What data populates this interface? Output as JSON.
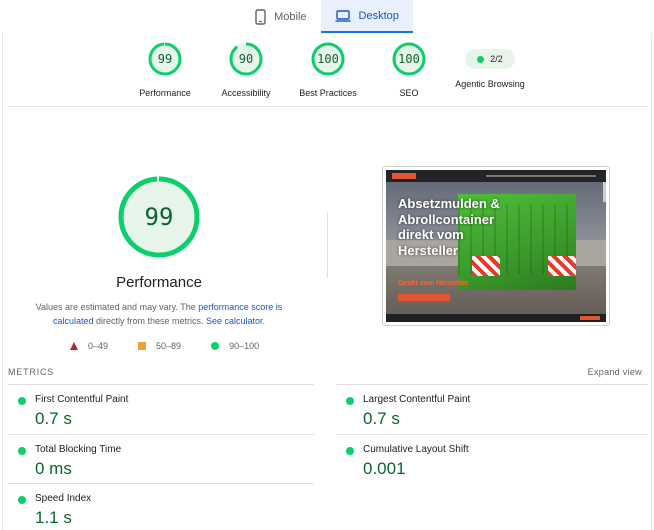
{
  "tabs": [
    {
      "label": "Mobile",
      "icon": "phone-icon",
      "active": false
    },
    {
      "label": "Desktop",
      "icon": "laptop-icon",
      "active": true
    }
  ],
  "categories": [
    {
      "score": "99",
      "label": "Performance",
      "fraction": 0.99
    },
    {
      "score": "90",
      "label": "Accessibility",
      "fraction": 0.9
    },
    {
      "score": "100",
      "label": "Best Practices",
      "fraction": 1.0
    },
    {
      "score": "100",
      "label": "SEO",
      "fraction": 1.0
    },
    {
      "score": "2/2",
      "label": "Agentic Browsing"
    }
  ],
  "performance": {
    "score": "99",
    "fraction": 0.99,
    "title": "Performance",
    "desc_before": "Values are estimated and may vary. The ",
    "desc_link1": "performance score is calculated",
    "desc_middle": " directly from these metrics. ",
    "desc_link2": "See calculator",
    "desc_end": "."
  },
  "legend": [
    {
      "range": "0–49",
      "icon": "triangle-icon",
      "color": "#c5221f"
    },
    {
      "range": "50–89",
      "icon": "square-icon",
      "color": "#e8a33d"
    },
    {
      "range": "90–100",
      "icon": "circle-icon",
      "color": "#0cce6b"
    }
  ],
  "screenshot": {
    "headline": "Absetzmulden & Abrollcontainer direkt vom Hersteller",
    "subline": "Direkt vom Hersteller"
  },
  "metrics": {
    "heading": "METRICS",
    "expand": "Expand view",
    "items": [
      {
        "name": "First Contentful Paint",
        "value": "0.7 s"
      },
      {
        "name": "Largest Contentful Paint",
        "value": "0.7 s"
      },
      {
        "name": "Total Blocking Time",
        "value": "0 ms"
      },
      {
        "name": "Cumulative Layout Shift",
        "value": "0.001"
      },
      {
        "name": "Speed Index",
        "value": "1.1 s"
      }
    ]
  },
  "colors": {
    "pass": "#0cce6b",
    "pass_text": "#0d652d",
    "link": "#1a56c4",
    "accent": "#1a73e8"
  }
}
